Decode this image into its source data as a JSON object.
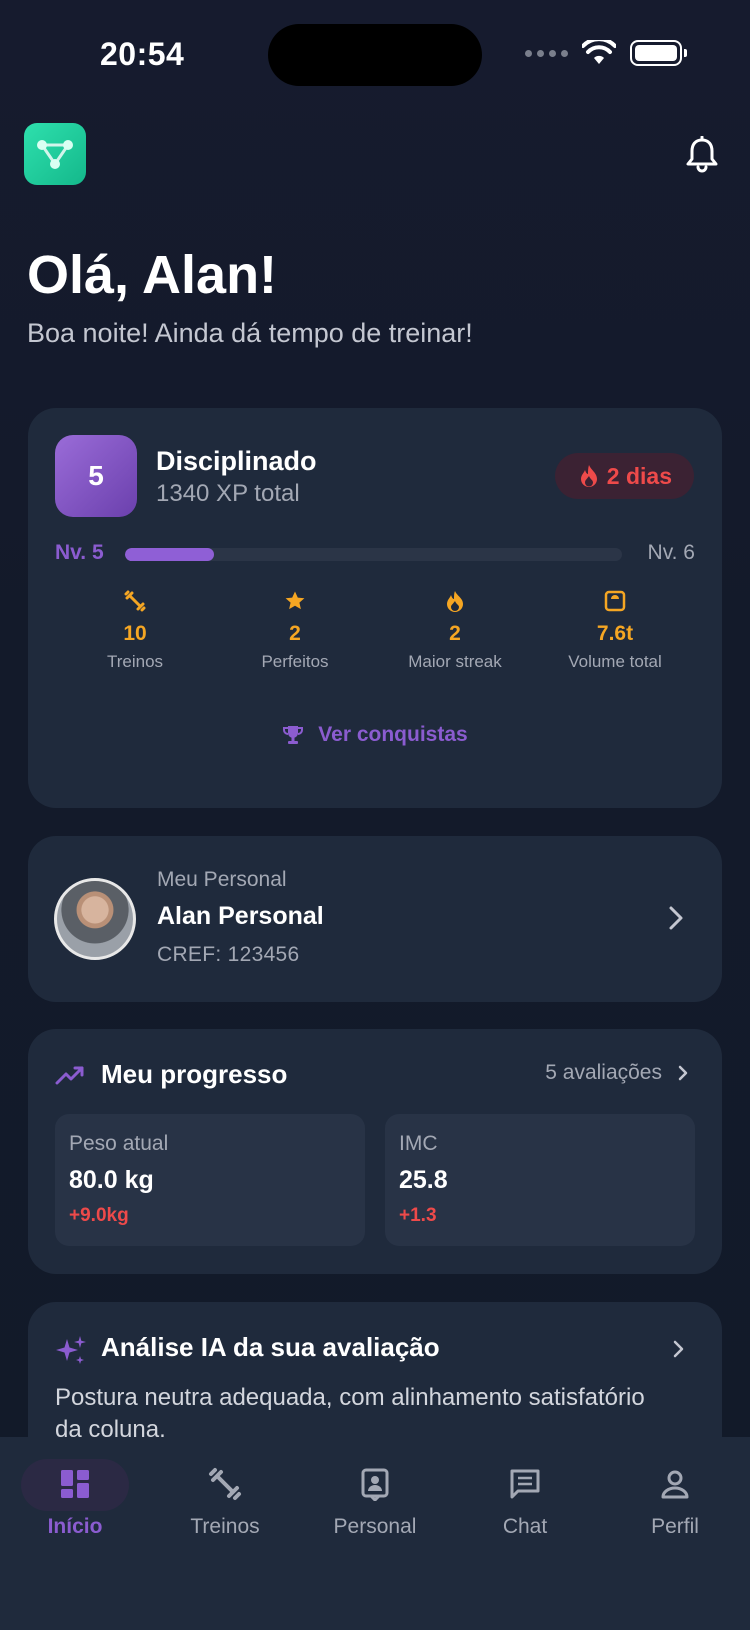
{
  "status_bar": {
    "time": "20:54"
  },
  "header": {
    "logo_icon": "network-nodes-icon",
    "bell_icon": "bell-icon"
  },
  "greeting": {
    "title": "Olá, Alan!",
    "subtitle": "Boa noite! Ainda dá tempo de treinar!"
  },
  "level_card": {
    "level": "5",
    "title": "Disciplinado",
    "xp": "1340 XP total",
    "streak": "2 dias",
    "level_from": "Nv. 5",
    "level_to": "Nv. 6",
    "progress_fraction": 0.18,
    "stats": [
      {
        "icon": "dumbbell-icon",
        "value": "10",
        "label": "Treinos"
      },
      {
        "icon": "star-icon",
        "value": "2",
        "label": "Perfeitos"
      },
      {
        "icon": "flame-icon",
        "value": "2",
        "label": "Maior streak"
      },
      {
        "icon": "scale-icon",
        "value": "7.6t",
        "label": "Volume total"
      }
    ],
    "achievements_label": "Ver conquistas"
  },
  "personal_card": {
    "kicker": "Meu Personal",
    "name": "Alan Personal",
    "cref": "CREF: 123456"
  },
  "progress_card": {
    "title": "Meu progresso",
    "link": "5 avaliações",
    "metrics": [
      {
        "label": "Peso atual",
        "value": "80.0 kg",
        "delta": "+9.0kg"
      },
      {
        "label": "IMC",
        "value": "25.8",
        "delta": "+1.3"
      }
    ]
  },
  "ai_card": {
    "title": "Análise IA da sua avaliação",
    "text": "Postura neutra adequada, com alinhamento satisfatório da coluna."
  },
  "tabs": [
    {
      "label": "Início",
      "icon": "dashboard-icon",
      "active": true
    },
    {
      "label": "Treinos",
      "icon": "dumbbell-icon",
      "active": false
    },
    {
      "label": "Personal",
      "icon": "id-badge-icon",
      "active": false
    },
    {
      "label": "Chat",
      "icon": "chat-icon",
      "active": false
    },
    {
      "label": "Perfil",
      "icon": "user-icon",
      "active": false
    }
  ],
  "colors": {
    "accent_purple": "#8b5cd0",
    "accent_orange": "#f5a623",
    "danger_red": "#ee4a4a",
    "card_bg": "#1f2a3c",
    "brand_green": "#1fcc9b"
  }
}
